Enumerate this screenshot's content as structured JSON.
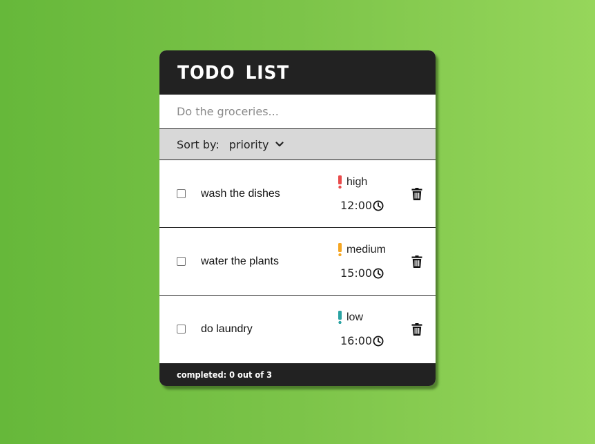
{
  "app": {
    "title": "TODO LIST"
  },
  "new_todo": {
    "placeholder": "Do the groceries...",
    "value": ""
  },
  "sort": {
    "label": "Sort by:",
    "selected": "priority",
    "icon": "chevron-down-icon"
  },
  "todos": [
    {
      "text": "wash the dishes",
      "checked": false,
      "priority": "high",
      "priority_color": "#e94b4b",
      "time": "12:00",
      "time_icon": "clock-icon",
      "delete_icon": "trash-icon"
    },
    {
      "text": "water the plants",
      "checked": false,
      "priority": "medium",
      "priority_color": "#f5a623",
      "time": "15:00",
      "time_icon": "clock-icon",
      "delete_icon": "trash-icon"
    },
    {
      "text": "do laundry",
      "checked": false,
      "priority": "low",
      "priority_color": "#2aa3a3",
      "time": "16:00",
      "time_icon": "clock-icon",
      "delete_icon": "trash-icon"
    }
  ],
  "footer": {
    "completed_text": "completed: 0 out of 3"
  },
  "colors": {
    "header_bg": "#222222",
    "sortbar_bg": "#d8d8d8",
    "background_gradient_start": "#66b83a",
    "background_gradient_end": "#96d65b"
  }
}
